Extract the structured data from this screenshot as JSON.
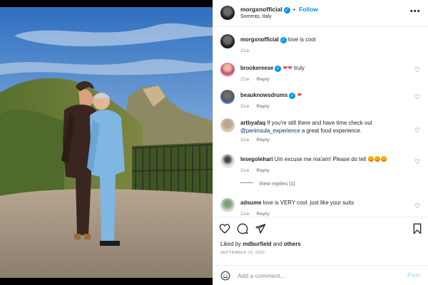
{
  "post": {
    "username": "morgxnofficial",
    "follow_label": "Follow",
    "dot": "•",
    "location": "Sorrento, Italy",
    "more_label": "•••",
    "caption": "love is cool",
    "caption_time": "21w"
  },
  "comments": [
    {
      "username": "brookereese",
      "text": "truly",
      "time": "21w",
      "reply": "Reply"
    },
    {
      "username": "beauknowsdrums",
      "text": "",
      "time": "21w",
      "reply": "Reply"
    },
    {
      "username": "artbyafaq",
      "text": "If you're still there and have time check out",
      "mention": "@peninsula_experience",
      "text2": "a great food experience.",
      "time": "21w",
      "reply": "Reply"
    },
    {
      "username": "lesegolehari",
      "text": "Um excuse me ma'am! Please do tell",
      "time": "21w",
      "reply": "Reply"
    },
    {
      "username": "adsume",
      "text": "love is VERY cool. just like your suits",
      "time": "21w",
      "reply": "Reply"
    }
  ],
  "view_replies": "View replies (1)",
  "likes": {
    "prefix": "Liked by",
    "user": "mdburfield",
    "and": "and",
    "others": "others"
  },
  "date": "SEPTEMBER 19, 2022",
  "add_comment": {
    "placeholder": "Add a comment...",
    "post_label": "Post"
  },
  "icons": {
    "like": "heart-icon",
    "comment": "comment-icon",
    "share": "paper-plane-icon",
    "save": "bookmark-icon",
    "emoji": "smiley-icon",
    "verified": "verified-badge-icon"
  },
  "colors": {
    "accent": "#0095f6",
    "heart": "#ed4956",
    "muted": "#8e8e8e"
  }
}
